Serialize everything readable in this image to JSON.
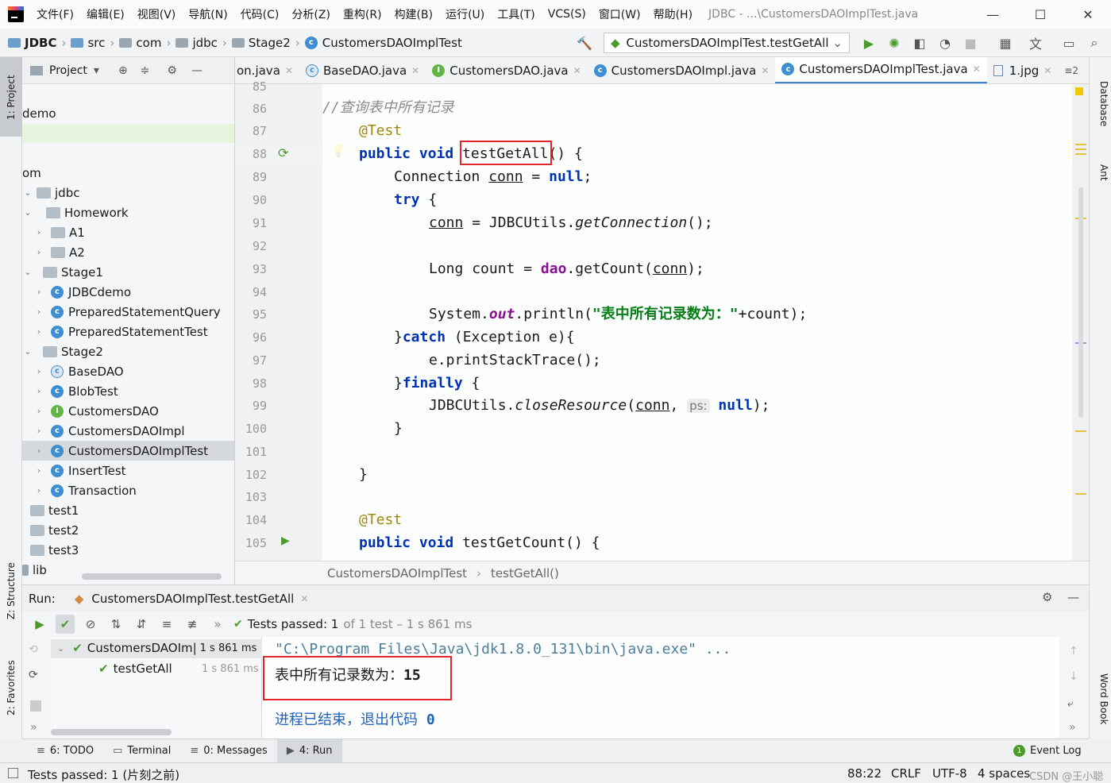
{
  "menu": [
    "文件(F)",
    "编辑(E)",
    "视图(V)",
    "导航(N)",
    "代码(C)",
    "分析(Z)",
    "重构(R)",
    "构建(B)",
    "运行(U)",
    "工具(T)",
    "VCS(S)",
    "窗口(W)",
    "帮助(H)"
  ],
  "window_title": "JDBC - ...\\CustomersDAOImplTest.java",
  "breadcrumb": [
    "JDBC",
    "src",
    "com",
    "jdbc",
    "Stage2",
    "CustomersDAOImplTest"
  ],
  "run_config": "CustomersDAOImplTest.testGetAll",
  "left_strip": {
    "project": "1: Project",
    "structure": "Z: Structure",
    "favorites": "2: Favorites"
  },
  "right_strip": {
    "database": "Database",
    "ant": "Ant",
    "wordbook": "Word Book"
  },
  "project_panel": {
    "title": "Project",
    "items": [
      {
        "label": "demo"
      },
      {
        "label": "om"
      },
      {
        "label": "jdbc"
      },
      {
        "label": "Homework"
      },
      {
        "label": "A1"
      },
      {
        "label": "A2"
      },
      {
        "label": "Stage1"
      },
      {
        "label": "JDBCdemo"
      },
      {
        "label": "PreparedStatementQuery"
      },
      {
        "label": "PreparedStatementTest"
      },
      {
        "label": "Stage2"
      },
      {
        "label": "BaseDAO"
      },
      {
        "label": "BlobTest"
      },
      {
        "label": "CustomersDAO"
      },
      {
        "label": "CustomersDAOImpl"
      },
      {
        "label": "CustomersDAOImplTest"
      },
      {
        "label": "InsertTest"
      },
      {
        "label": "Transaction"
      },
      {
        "label": "test1"
      },
      {
        "label": "test2"
      },
      {
        "label": "test3"
      },
      {
        "label": "lib"
      }
    ]
  },
  "tabs": [
    "on.java",
    "BaseDAO.java",
    "CustomersDAO.java",
    "CustomersDAOImpl.java",
    "CustomersDAOImplTest.java",
    "1.jpg",
    "≡2"
  ],
  "editor": {
    "line_numbers": [
      "85",
      "86",
      "87",
      "88",
      "89",
      "90",
      "91",
      "92",
      "93",
      "94",
      "95",
      "96",
      "97",
      "98",
      "99",
      "100",
      "101",
      "102",
      "103",
      "104",
      "105"
    ],
    "breadcrumb": [
      "CustomersDAOImplTest",
      "testGetAll()"
    ]
  },
  "code": {
    "comment": "//查询表中所有记录",
    "annotation": "@Test",
    "kw_public": "public",
    "kw_void": "void",
    "method_name": "testGetAll",
    "paren_open": "() {",
    "conn_type": "Connection",
    "conn_var": "conn",
    "eq": "=",
    "kw_null": "null",
    "semi": ";",
    "kw_try": "try",
    "brace_open": "{",
    "utils": "JDBCUtils",
    "get_conn": "getConnection",
    "call_end": "();",
    "long_type": "Long",
    "count_var": "count",
    "dao": "dao",
    "get_count": ".getCount(",
    "call_close": ");",
    "system": "System.",
    "out": "out",
    "println": ".println(",
    "string_lit": "\"表中所有记录数为：\"",
    "plus_count": "+count);",
    "catch_open": "}",
    "kw_catch": "catch",
    "catch_arg": " (Exception e){",
    "stacktrace": "e.printStackTrace();",
    "kw_finally": "finally",
    "close_res": "closeResource",
    "paren": "(",
    "comma": ",",
    "ps_hint": "ps:",
    "close_end": ");",
    "brace_close": "}",
    "method2": "testGetCount"
  },
  "run": {
    "label": "Run:",
    "config_tab": "CustomersDAOImplTest.testGetAll",
    "status_bold": "Tests passed: 1",
    "status_rest": "of 1 test – 1 s 861 ms",
    "tree": [
      {
        "name": "CustomersDAOIm|",
        "time": "1 s 861 ms"
      },
      {
        "name": "testGetAll",
        "time": "1 s 861 ms"
      }
    ],
    "console": {
      "cmd": "\"C:\\Program Files\\Java\\jdk1.8.0_131\\bin\\java.exe\" ...",
      "output_label": "表中所有记录数为：",
      "output_value": "15",
      "exit_label": "进程已结束，退出代码",
      "exit_code": "0"
    }
  },
  "bottom_tabs": [
    "6: TODO",
    "Terminal",
    "0: Messages",
    "4: Run"
  ],
  "event_log": {
    "count": "1",
    "label": "Event Log"
  },
  "status": {
    "message": "Tests passed: 1 (片刻之前)",
    "position": "88:22",
    "line_sep": "CRLF",
    "encoding": "UTF-8",
    "indent": "4 spaces",
    "watermark": "CSDN @王小聪"
  }
}
